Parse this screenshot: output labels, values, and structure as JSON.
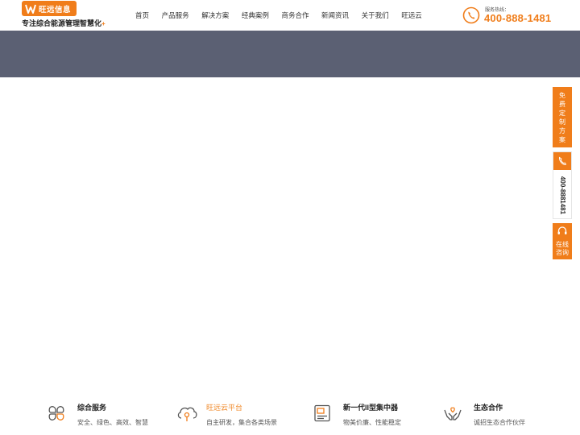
{
  "header": {
    "logo_text": "旺远信息",
    "slogan": "专注综合能源管理智慧化",
    "slogan_suffix": "+",
    "nav": [
      "首页",
      "产品服务",
      "解决方案",
      "经典案例",
      "商务合作",
      "新闻资讯",
      "关于我们",
      "旺远云"
    ],
    "hotline_label": "服务热线：",
    "hotline_number": "400-888-1481"
  },
  "banner": {
    "color": "#5b6073"
  },
  "side_float": {
    "quote_chars": [
      "免",
      "费",
      "定",
      "制",
      "方",
      "案"
    ],
    "phone_number": "400-8881481",
    "consult_chars": [
      "在线",
      "咨询"
    ]
  },
  "features": [
    {
      "title": "综合服务",
      "desc": "安全、绿色、高效、智慧",
      "icon": "four-petal-icon"
    },
    {
      "title": "旺远云平台",
      "desc": "自主研发，集合各类场景",
      "icon": "cloud-icon",
      "active": true
    },
    {
      "title": "新一代II型集中器",
      "desc": "物美价廉、性能稳定",
      "icon": "device-icon"
    },
    {
      "title": "生态合作",
      "desc": "诚招生态合作伙伴",
      "icon": "hands-heart-icon"
    }
  ],
  "colors": {
    "accent": "#f07d1a",
    "banner": "#5b6073"
  }
}
